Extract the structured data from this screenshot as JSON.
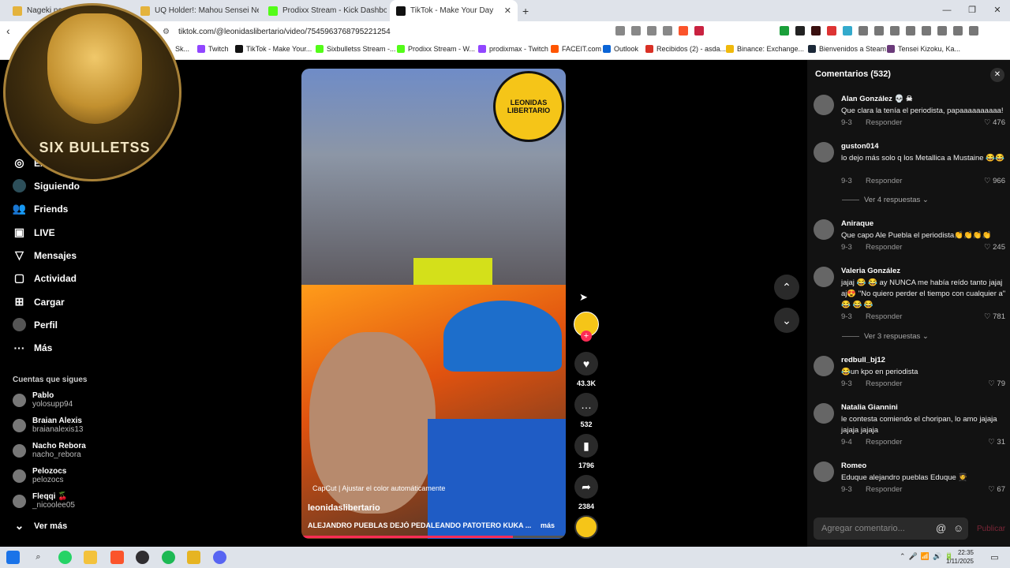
{
  "browser": {
    "tabs": [
      {
        "title": "Nageki no"
      },
      {
        "title": "UQ Holder!: Mahou Sensei Negima!"
      },
      {
        "title": "Prodixx Stream - Kick Dashboard"
      },
      {
        "title": "TikTok - Make Your Day"
      }
    ],
    "new_tab": "+",
    "url": "tiktok.com/@leonidaslibertario/video/7545963768795221254",
    "bookmarks": [
      "Sk...",
      "Twitch",
      "TikTok - Make Your...",
      "Sixbulletss Stream -...",
      "Prodixx Stream - W...",
      "prodixmax - Twitch",
      "FACEIT.com",
      "Outlook",
      "Recibidos (2) - asda...",
      "Binance: Exchange...",
      "Bienvenidos a Steam",
      "Tensei Kizoku, Ka..."
    ]
  },
  "overlay_logo": {
    "text": "SIX BULLETSS"
  },
  "sidebar": {
    "items": [
      {
        "label": "Ex",
        "icon": "compass-icon"
      },
      {
        "label": "Siguiendo",
        "icon": "following-icon"
      },
      {
        "label": "Friends",
        "icon": "friends-icon"
      },
      {
        "label": "LIVE",
        "icon": "live-icon"
      },
      {
        "label": "Mensajes",
        "icon": "messages-icon"
      },
      {
        "label": "Actividad",
        "icon": "activity-icon"
      },
      {
        "label": "Cargar",
        "icon": "upload-icon"
      },
      {
        "label": "Perfil",
        "icon": "profile-icon"
      },
      {
        "label": "Más",
        "icon": "more-icon"
      }
    ],
    "following_title": "Cuentas que sigues",
    "following": [
      {
        "name": "Pablo",
        "handle": "yolosupp94"
      },
      {
        "name": "Braian Alexis",
        "handle": "braianalexis13"
      },
      {
        "name": "Nacho Rebora",
        "handle": "nacho_rebora"
      },
      {
        "name": "Pelozocs",
        "handle": "pelozocs"
      },
      {
        "name": "Fleqqi 🍒",
        "handle": "_nicoolee05"
      }
    ],
    "see_more": "Ver más"
  },
  "video": {
    "badge_text": "LEONIDAS LIBERTARIO",
    "capcut": "CapCut | Ajustar el color automáticamente",
    "username": "leonidaslibertario",
    "description": "ALEJANDRO PUEBLAS DEJÓ PEDALEANDO PATOTERO KUKA ...",
    "more": "más",
    "progress": 0.8,
    "likes": "43.3K",
    "comments": "532",
    "saves": "1796",
    "shares": "2384"
  },
  "comments": {
    "title": "Comentarios (532)",
    "items": [
      {
        "name": "Alan González 💀 ☠",
        "text": "Que clara la tenía el periodista, papaaaaaaaaaa!",
        "date": "9-3",
        "reply": "Responder",
        "likes": "476"
      },
      {
        "name": "guston014",
        "text": "lo dejo más solo q los Metallica a Mustaine 😂😂",
        "date": "9-3",
        "reply": "Responder",
        "likes": "966"
      },
      {
        "name": "Aniraque",
        "text": "Que capo Ale Puebla el periodista👏👏👏👏",
        "date": "9-3",
        "reply": "Responder",
        "likes": "245"
      },
      {
        "name": "Valeria González",
        "text": "jajaj 😂 😂 ay NUNCA me había reído tanto jajaj aj😍 \"No quiero perder el tiempo con cualquier a\" 😂 😂 😂",
        "date": "9-3",
        "reply": "Responder",
        "likes": "781"
      },
      {
        "name": "redbull_bj12",
        "text": "😂un kpo en periodista",
        "date": "9-3",
        "reply": "Responder",
        "likes": "79"
      },
      {
        "name": "Natalia Giannini",
        "text": "le contesta comiendo el choripan, lo amo jajaja jajaja jajaja",
        "date": "9-4",
        "reply": "Responder",
        "likes": "31"
      },
      {
        "name": "Romeo",
        "text": "Eduque alejandro pueblas Eduque 🧑‍🎓",
        "date": "9-3",
        "reply": "Responder",
        "likes": "67"
      }
    ],
    "view_replies_1": "Ver 4 respuestas",
    "view_replies_2": "Ver 3 respuestas",
    "input_placeholder": "Agregar comentario...",
    "post": "Publicar"
  },
  "taskbar": {
    "time": "22:35",
    "date": "1/11/2025"
  }
}
